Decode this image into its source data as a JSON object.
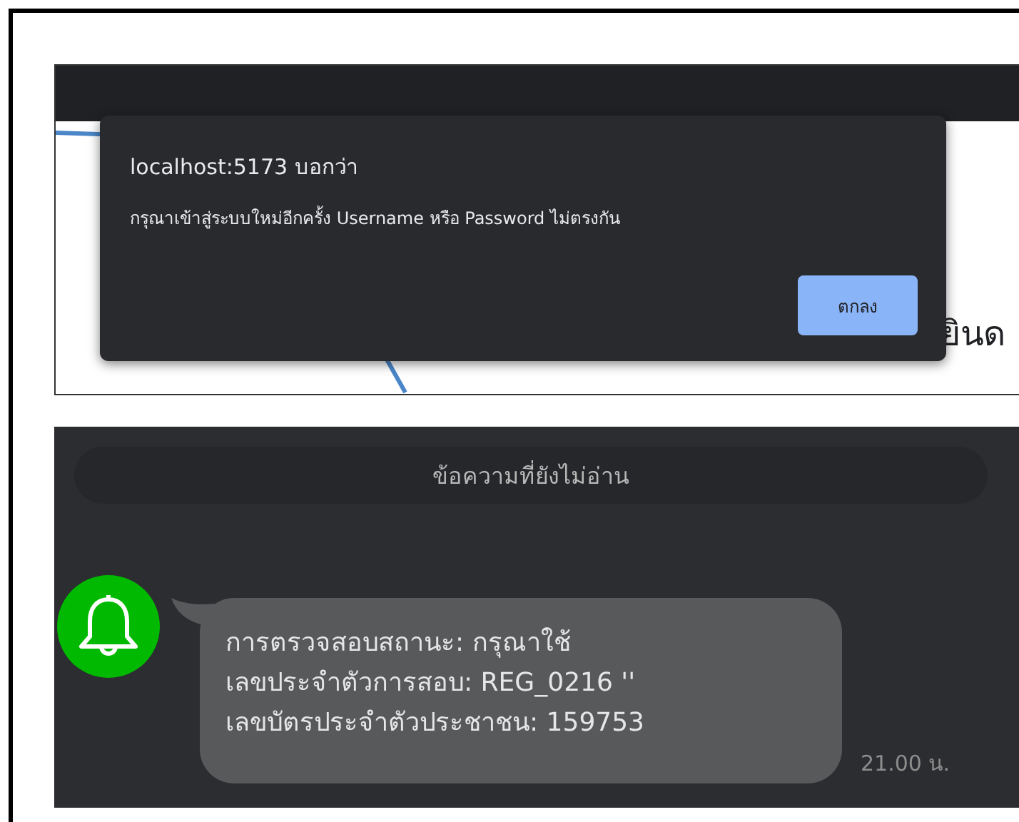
{
  "alert_screenshot": {
    "dialog": {
      "title": "localhost:5173 บอกว่า",
      "message": "กรุณาเข้าสู่ระบบใหม่อีกครั้ง Username หรือ Password ไม่ตรงกัน",
      "button": "ตกลง"
    },
    "background_heading": "ยินด"
  },
  "chat_screenshot": {
    "divider": "ข้อความที่ยังไม่อ่าน",
    "message": {
      "lines": [
        "การตรวจสอบสถานะ:  กรุณาใช้",
        "เลขประจำตัวการสอบ: REG_0216 ''",
        "เลขบัตรประจำตัวประชาชน: 159753"
      ],
      "time": "21.00 น."
    }
  }
}
